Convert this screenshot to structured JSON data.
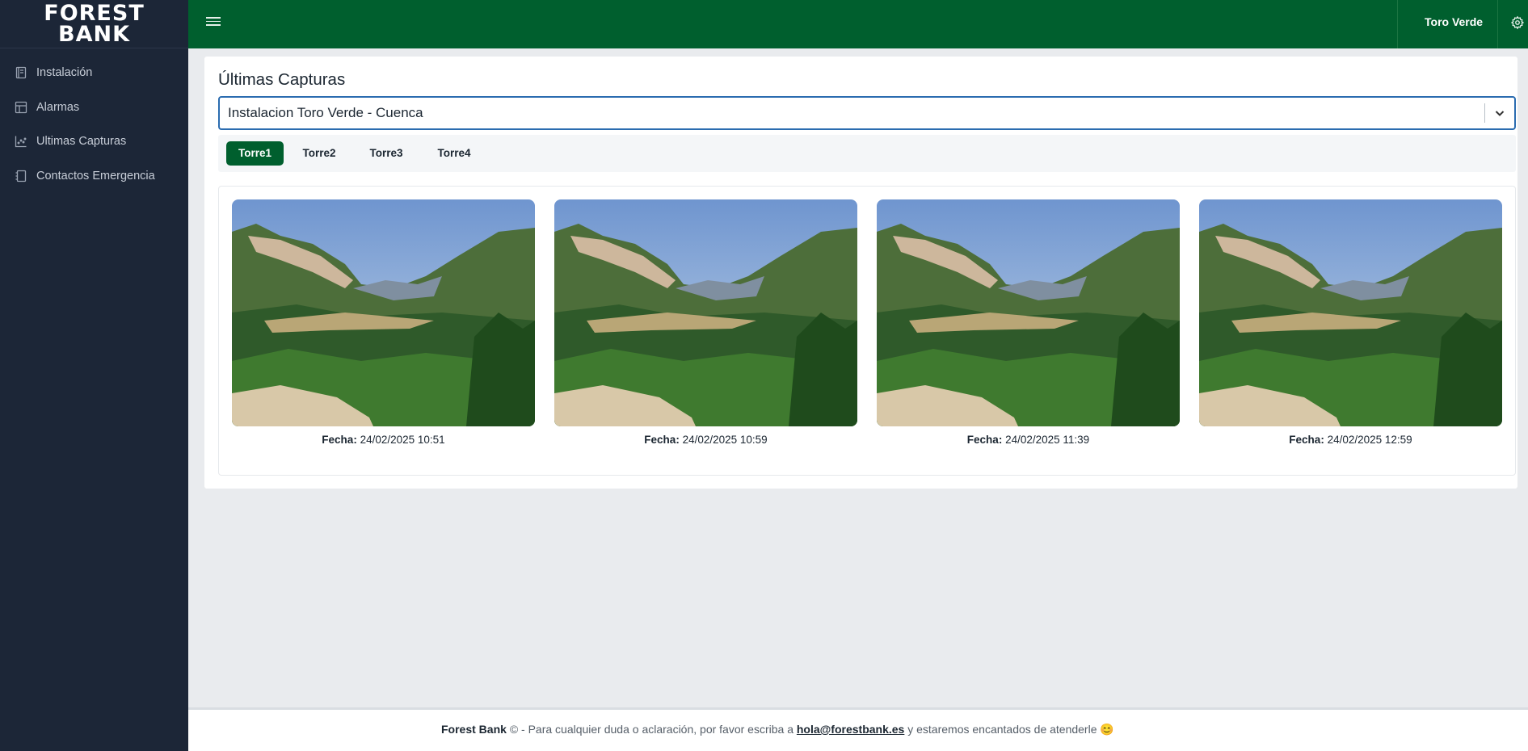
{
  "brand": {
    "logo_line1": "FOREST",
    "logo_line2": "BANK"
  },
  "sidebar": {
    "items": [
      {
        "label": "Instalación",
        "icon": "book-icon"
      },
      {
        "label": "Alarmas",
        "icon": "layout-icon"
      },
      {
        "label": "Ultimas Capturas",
        "icon": "chart-icon"
      },
      {
        "label": "Contactos Emergencia",
        "icon": "contacts-icon"
      }
    ]
  },
  "topbar": {
    "user_name": "Toro Verde",
    "menu_icon": "hamburger-icon",
    "settings_icon": "gear-icon"
  },
  "main": {
    "title": "Últimas Capturas",
    "installation_select": {
      "value": "Instalacion Toro Verde - Cuenca"
    },
    "tabs": [
      {
        "label": "Torre1",
        "active": true
      },
      {
        "label": "Torre2",
        "active": false
      },
      {
        "label": "Torre3",
        "active": false
      },
      {
        "label": "Torre4",
        "active": false
      }
    ],
    "captures": [
      {
        "date_label": "Fecha:",
        "date": "24/02/2025 10:51"
      },
      {
        "date_label": "Fecha:",
        "date": "24/02/2025 10:59"
      },
      {
        "date_label": "Fecha:",
        "date": "24/02/2025 11:39"
      },
      {
        "date_label": "Fecha:",
        "date": "24/02/2025 12:59"
      }
    ]
  },
  "footer": {
    "brand": "Forest Bank",
    "text_before": "© - Para cualquier duda o aclaración, por favor escriba a",
    "email": "hola@forestbank.es",
    "text_after": "y estaremos encantados de atenderle 😊"
  },
  "colors": {
    "sidebar_bg": "#1c2637",
    "topbar_bg": "#005f2e",
    "active_tab": "#005f2e",
    "select_border": "#2b6cb0"
  }
}
